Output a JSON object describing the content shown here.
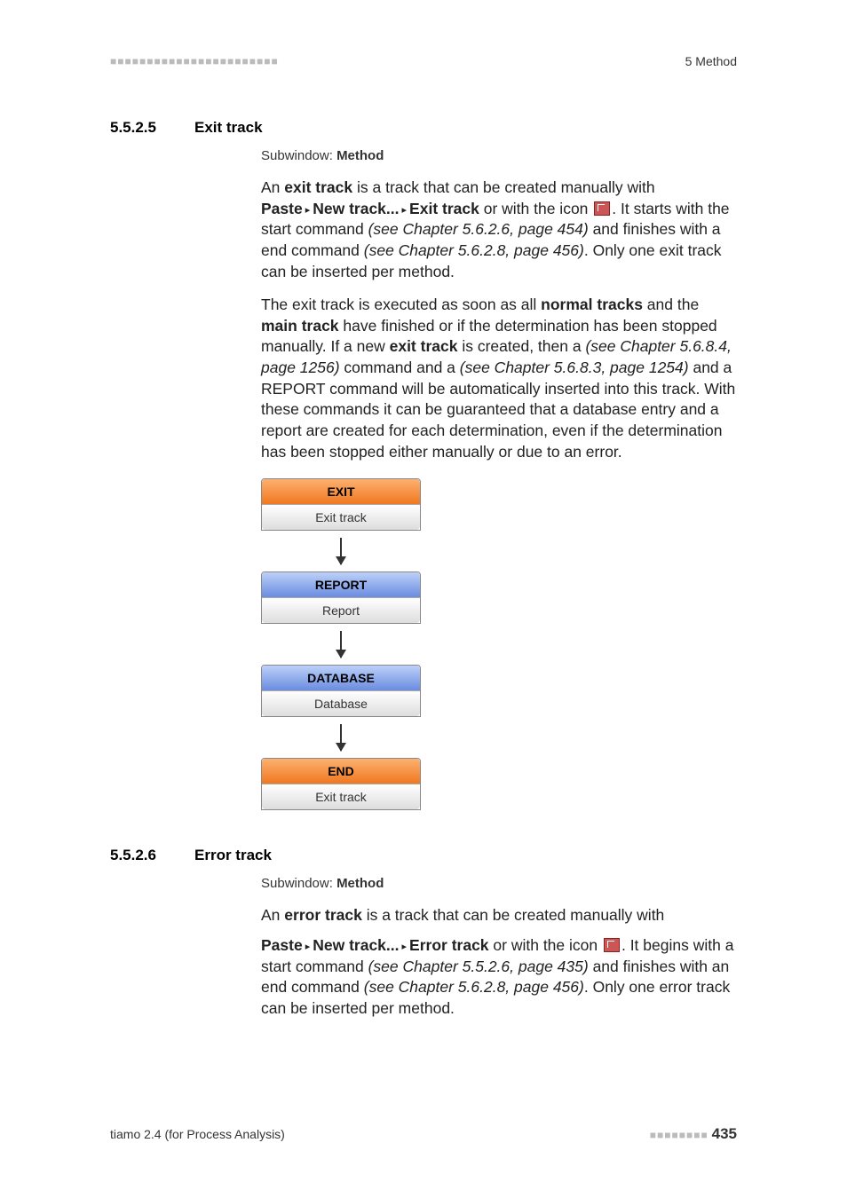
{
  "header": {
    "dots": "■■■■■■■■■■■■■■■■■■■■■■■",
    "right": "5 Method"
  },
  "sections": [
    {
      "num": "5.5.2.5",
      "title": "Exit track",
      "subwindow_label": "Subwindow:",
      "subwindow_value": "Method",
      "p1_a": "An ",
      "p1_b": "exit track",
      "p1_c": " is a track that can be created manually with ",
      "p1_d": "Paste",
      "p1_e": "New track...",
      "p1_f": "Exit track",
      "p1_g": " or with the icon ",
      "p1_h": ". It starts with the start command ",
      "p1_i": "(see Chapter 5.6.2.6, page 454)",
      "p1_j": " and finishes with a end command ",
      "p1_k": "(see Chapter 5.6.2.8, page 456)",
      "p1_l": ". Only one exit track can be inserted per method.",
      "p2_a": "The exit track is executed as soon as all ",
      "p2_b": "normal tracks",
      "p2_c": " and the ",
      "p2_d": "main track",
      "p2_e": " have finished or if the determination has been stopped manually. If a new ",
      "p2_f": "exit track",
      "p2_g": " is created, then a ",
      "p2_h": "(see Chapter 5.6.8.4, page 1256)",
      "p2_i": " command and a ",
      "p2_j": "(see Chapter 5.6.8.3, page 1254)",
      "p2_k": " and a REPORT command will be automatically inserted into this track. With these commands it can be guaranteed that a database entry and a report are created for each determination, even if the determination has been stopped either manually or due to an error.",
      "diagram": [
        {
          "head": "EXIT",
          "body": "Exit track",
          "type": "orange"
        },
        {
          "head": "REPORT",
          "body": "Report",
          "type": "blue"
        },
        {
          "head": "DATABASE",
          "body": "Database",
          "type": "blue"
        },
        {
          "head": "END",
          "body": "Exit track",
          "type": "orange"
        }
      ]
    },
    {
      "num": "5.5.2.6",
      "title": "Error track",
      "subwindow_label": "Subwindow:",
      "subwindow_value": "Method",
      "p1_a": "An ",
      "p1_b": "error track",
      "p1_c": " is a track that can be created manually with",
      "p2_a": "Paste",
      "p2_b": "New track...",
      "p2_c": "Error track",
      "p2_d": " or with the icon ",
      "p2_e": ". It begins with a start command ",
      "p2_f": "(see Chapter 5.5.2.6, page 435)",
      "p2_g": " and finishes with an end command ",
      "p2_h": "(see Chapter 5.6.2.8, page 456)",
      "p2_i": ". Only one error track can be inserted per method."
    }
  ],
  "footer": {
    "left": "tiamo 2.4 (for Process Analysis)",
    "dots": "■■■■■■■■",
    "page": "435"
  },
  "tri": "▸"
}
